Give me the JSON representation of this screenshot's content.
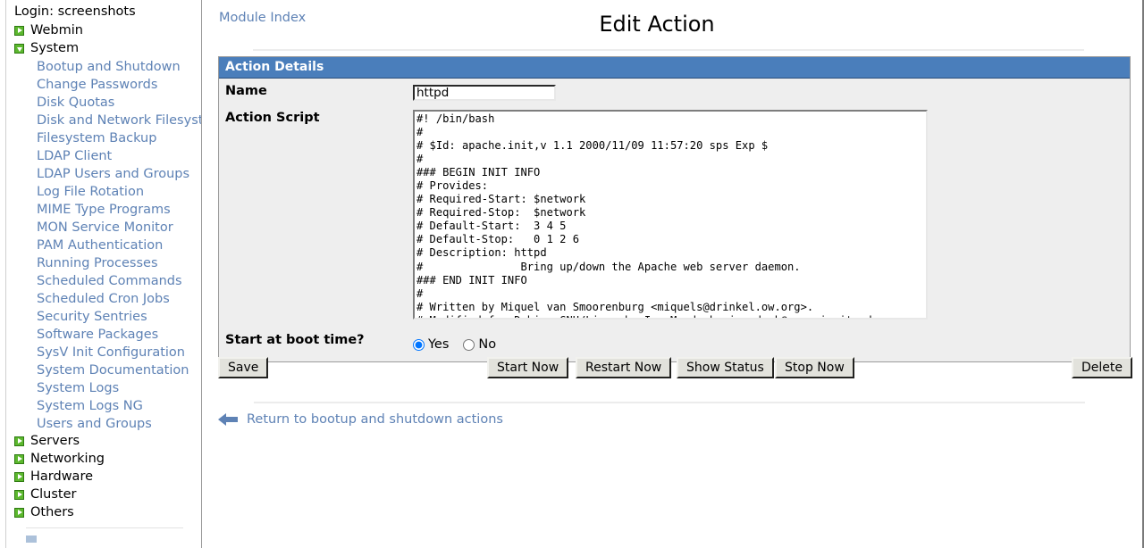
{
  "sidebar": {
    "login_text": "Login: screenshots",
    "categories": [
      {
        "label": "Webmin",
        "icon": "expand-triangle-right-icon",
        "state": "collapsed"
      },
      {
        "label": "System",
        "icon": "expand-triangle-down-icon",
        "state": "expanded"
      }
    ],
    "system_modules": [
      "Bootup and Shutdown",
      "Change Passwords",
      "Disk Quotas",
      "Disk and Network Filesystems",
      "Filesystem Backup",
      "LDAP Client",
      "LDAP Users and Groups",
      "Log File Rotation",
      "MIME Type Programs",
      "MON Service Monitor",
      "PAM Authentication",
      "Running Processes",
      "Scheduled Commands",
      "Scheduled Cron Jobs",
      "Security Sentries",
      "Software Packages",
      "SysV Init Configuration",
      "System Documentation",
      "System Logs",
      "System Logs NG",
      "Users and Groups"
    ],
    "trailing_categories": [
      {
        "label": "Servers",
        "icon": "expand-triangle-right-icon",
        "state": "collapsed"
      },
      {
        "label": "Networking",
        "icon": "expand-triangle-right-icon",
        "state": "collapsed"
      },
      {
        "label": "Hardware",
        "icon": "expand-triangle-right-icon",
        "state": "collapsed"
      },
      {
        "label": "Cluster",
        "icon": "expand-triangle-right-icon",
        "state": "collapsed"
      },
      {
        "label": "Others",
        "icon": "expand-triangle-right-icon",
        "state": "collapsed"
      }
    ]
  },
  "header": {
    "module_index_link": "Module Index",
    "page_title": "Edit Action"
  },
  "panel": {
    "title": "Action Details",
    "fields": {
      "name_label": "Name",
      "name_value": "httpd",
      "script_label": "Action Script",
      "script_value": "#! /bin/bash\n#\n# $Id: apache.init,v 1.1 2000/11/09 11:57:20 sps Exp $\n#\n### BEGIN INIT INFO\n# Provides:\n# Required-Start: $network\n# Required-Stop:  $network\n# Default-Start:  3 4 5\n# Default-Stop:   0 1 2 6\n# Description: httpd\n#               Bring up/down the Apache web server daemon.\n### END INIT INFO\n#\n# Written by Miquel van Smoorenburg <miquels@drinkel.ow.org>.\n# Modified for Debian GNU/Linux by Ian Murdock <imurdock@gnu.ai.mit.edu>.\n",
      "boot_label": "Start at boot time?",
      "boot_yes": "Yes",
      "boot_no": "No",
      "boot_selected": "Yes"
    }
  },
  "buttons": {
    "save": "Save",
    "start_now": "Start Now",
    "restart_now": "Restart Now",
    "show_status": "Show Status",
    "stop_now": "Stop Now",
    "delete": "Delete"
  },
  "footer": {
    "return_link": "Return to bootup and shutdown actions"
  },
  "colors": {
    "panel_header": "#4a7ebb",
    "link": "#5e82b5",
    "category_icon": "#5cb82e",
    "panel_body": "#eeeeee"
  }
}
